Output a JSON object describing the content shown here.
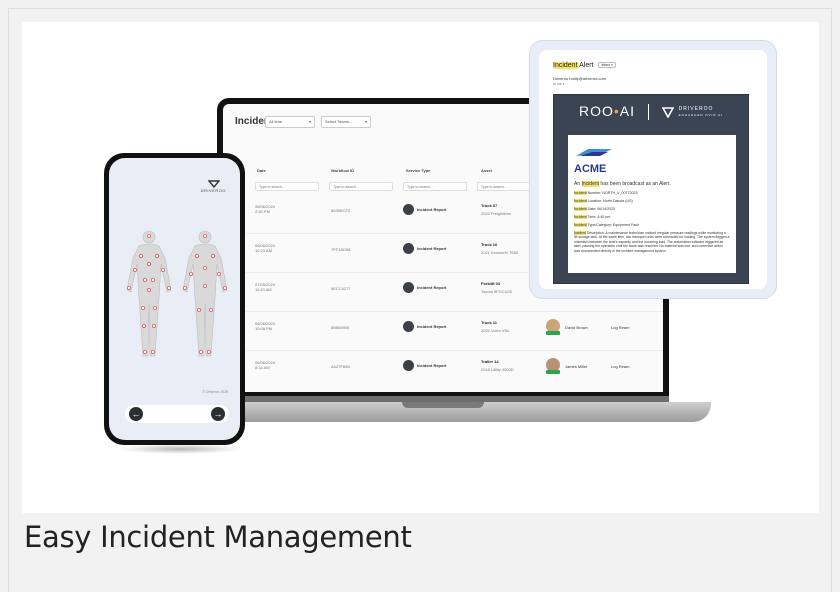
{
  "caption": "Easy Incident Management",
  "laptop": {
    "title": "Incidents",
    "filter_time": "All time",
    "filter_teams": "Select Teams...",
    "columns": [
      "Date",
      "Workflow ID",
      "Service Type",
      "Asset"
    ],
    "search_placeholders": [
      "Type to search...",
      "Type to search...",
      "Type to search...",
      "Type to search..."
    ],
    "rows": [
      {
        "date": "06/06/2024",
        "time": "2:30 PM",
        "wid": "8635BCF2",
        "service": "Incident Report",
        "asset": "Truck 07",
        "asset_sub": "2022 Freightliner",
        "person": "",
        "action": ""
      },
      {
        "date": "06/06/2024",
        "time": "10:23 AM",
        "wid": "7FF1AD98",
        "service": "Incident Report",
        "asset": "Truck 16",
        "asset_sub": "2021 Kenworth T680",
        "person": "",
        "action": ""
      },
      {
        "date": "07/05/2024",
        "time": "11:43 AM",
        "wid": "9ECC4277",
        "service": "Incident Report",
        "asset": "Forklift 03",
        "asset_sub": "Toyota 8FGCU25",
        "person": "",
        "action": ""
      },
      {
        "date": "06/06/2024",
        "time": "10:08 PM",
        "wid": "85B06905",
        "service": "Incident Report",
        "asset": "Truck 11",
        "asset_sub": "2020 Volvo VNL",
        "person": "David Brown",
        "action": "Log Ream"
      },
      {
        "date": "06/06/2024",
        "time": "8:34 AM",
        "wid": "4A27F80B",
        "service": "Incident Report",
        "asset": "Trailer 14",
        "asset_sub": "2018 Utility 4000D",
        "person": "James Miller",
        "action": "Log Ream"
      }
    ]
  },
  "email": {
    "subject_hl": "Incident",
    "subject_rest": " Alert",
    "tag": "Inbox ×",
    "from": "Driveroo notify@driveroo.com",
    "to": "to me ▾",
    "brand_left": "ROO",
    "brand_dot": "•",
    "brand_right": "AI",
    "brand2_top": "DRIVEROO",
    "brand2_bottom": "ENHANCED DVIR AI",
    "acme": "ACME",
    "lead_pre": "An ",
    "lead_hl": "Incident",
    "lead_post": " has been broadcast as an Alert.",
    "lines": [
      {
        "k": "Incident",
        "v": " Number:  NORTH_V_0077202S"
      },
      {
        "k": "Incident",
        "v": " Location:  North Dakota (US)"
      },
      {
        "k": "Incident",
        "v": " Date:  06/14/2025"
      },
      {
        "k": "Incident",
        "v": " Time:  4:45 pm"
      },
      {
        "k": "Incident",
        "v": " Type/Category:  Equipment Fault"
      }
    ],
    "desc_k": "Incident",
    "desc": " Description: A maintenance technician noticed irregular pressure readings while monitoring a lift storage tank. At the same time, two transport units were scheduled for loading. The system flagged a mismatch between the tank's capacity and the incoming load. The automation software triggered an alert, pausing the operation until the issue was resolved. No material was lost, and corrective action was documented directly in the incident management system."
  },
  "phone": {
    "brand": "DRIVEROO",
    "copyright": "© Driveroo 2025",
    "prev": "←",
    "next": "→"
  },
  "colors": {
    "highlight": "#f4e36b",
    "dark_panel": "#3b4452",
    "accent": "#f2a24a",
    "acme_blue": "#2a3a8a"
  }
}
